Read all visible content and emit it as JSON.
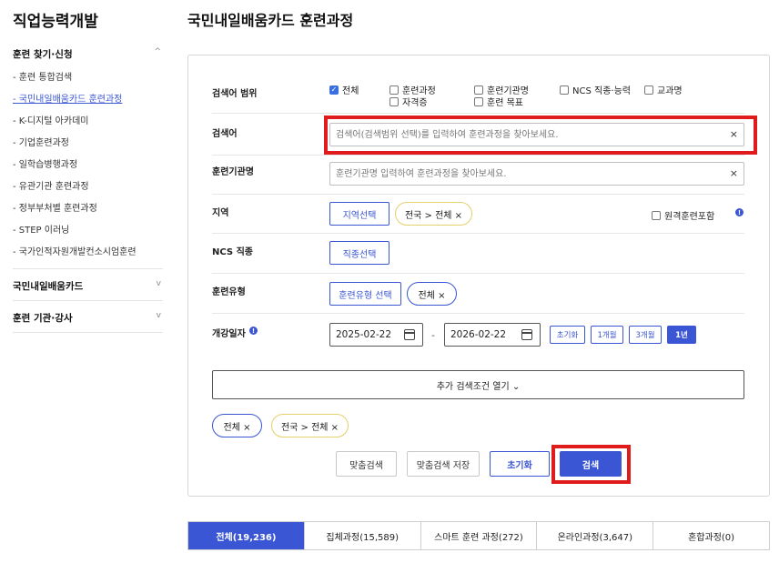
{
  "sidebar": {
    "title": "직업능력개발",
    "sections": [
      {
        "label": "훈련 찾기·신청",
        "chevron": "^"
      },
      {
        "label": "국민내일배움카드",
        "chevron": "v"
      },
      {
        "label": "훈련 기관·강사",
        "chevron": "v"
      }
    ],
    "items": [
      "- 훈련 통합검색",
      "- 국민내일배움카드 훈련과정",
      "- K-디지털 아카데미",
      "- 기업훈련과정",
      "- 일학습병행과정",
      "- 유관기관 훈련과정",
      "- 정부부처별 훈련과정",
      "- STEP 이러닝",
      "- 국가인적자원개발컨소시엄훈련"
    ]
  },
  "page_title": "국민내일배움카드 훈련과정",
  "form": {
    "scope": {
      "label": "검색어 범위",
      "options": [
        {
          "label": "전체",
          "checked": true
        },
        {
          "label": "훈련과정",
          "checked": false
        },
        {
          "label": "훈련기관명",
          "checked": false
        },
        {
          "label": "NCS 직종·능력",
          "checked": false
        },
        {
          "label": "교과명",
          "checked": false
        },
        {
          "label": "자격증",
          "checked": false
        },
        {
          "label": "훈련 목표",
          "checked": false
        }
      ]
    },
    "keyword": {
      "label": "검색어",
      "placeholder": "검색어(검색범위 선택)를 입력하여 훈련과정을 찾아보세요.",
      "clear": "×"
    },
    "institution": {
      "label": "훈련기관명",
      "placeholder": "훈련기관명 입력하여 훈련과정을 찾아보세요.",
      "clear": "×"
    },
    "region": {
      "label": "지역",
      "button": "지역선택",
      "chip": "전국 > 전체 ×",
      "remote_label": "원격훈련포함",
      "info": "!"
    },
    "ncs": {
      "label": "NCS 직종",
      "button": "직종선택"
    },
    "type": {
      "label": "훈련유형",
      "button": "훈련유형 선택",
      "chip": "전체 ×"
    },
    "date": {
      "label": "개강일자",
      "info": "!",
      "start": "2025-02-22",
      "separator": "-",
      "end": "2026-02-22",
      "buttons": [
        "초기화",
        "1개월",
        "3개월",
        "1년"
      ],
      "active": "1년"
    },
    "more": "추가 검색조건 열기 ⌄",
    "selected_chips": [
      "전체 ×",
      "전국 > 전체 ×"
    ],
    "actions": {
      "custom_search": "맞춤검색",
      "save_custom": "맞춤검색 저장",
      "reset": "초기화",
      "search": "검색"
    }
  },
  "tabs": [
    {
      "label": "전체(19,236)",
      "active": true
    },
    {
      "label": "집체과정(15,589)",
      "active": false
    },
    {
      "label": "스마트 훈련 과정(272)",
      "active": false
    },
    {
      "label": "온라인과정(3,647)",
      "active": false
    },
    {
      "label": "혼합과정(0)",
      "active": false
    }
  ],
  "colors": {
    "accent": "#3a56d4",
    "highlight": "#e01b1b",
    "chip_border": "#e5d06a"
  }
}
